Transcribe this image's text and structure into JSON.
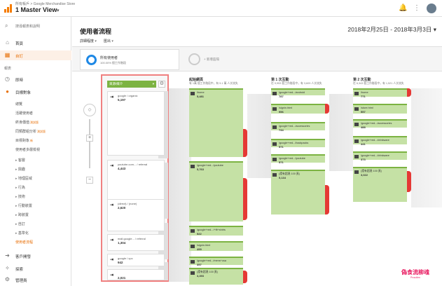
{
  "topbar": {
    "breadcrumb": "所有帳戶 > Google Merchandise Store",
    "view_name": "1 Master View",
    "icons": [
      "bell-icon",
      "more-icon",
      "account-avatar"
    ]
  },
  "sidebar": {
    "search_placeholder": "搜尋報表和說明",
    "top_items": [
      {
        "label": "首頁",
        "icon": "home-icon"
      },
      {
        "label": "自訂",
        "icon": "dashboard-icon"
      }
    ],
    "section_label": "報表",
    "items": [
      {
        "label": "即時",
        "icon": "clock-icon"
      },
      {
        "label": "目標對象",
        "icon": "person-icon"
      }
    ],
    "audience_subitems": [
      {
        "label": "總覽"
      },
      {
        "label": "活躍使用者"
      },
      {
        "label": "終身價值",
        "badge": "測試版"
      },
      {
        "label": "同類群組分析",
        "badge": "測試版"
      },
      {
        "label": "目標對象",
        "badge": "新"
      },
      {
        "label": "使用者多層檢視"
      },
      {
        "label": "客層",
        "arrow": true
      },
      {
        "label": "興趣",
        "arrow": true
      },
      {
        "label": "地理區域",
        "arrow": true
      },
      {
        "label": "行為",
        "arrow": true
      },
      {
        "label": "技術",
        "arrow": true
      },
      {
        "label": "行動裝置",
        "arrow": true
      },
      {
        "label": "跨裝置",
        "arrow": true
      },
      {
        "label": "自訂",
        "arrow": true
      },
      {
        "label": "基準化",
        "arrow": true
      },
      {
        "label": "使用者流程",
        "selected": true
      }
    ],
    "bottom_items": [
      {
        "label": "客戶開發",
        "icon": "acquisition-icon"
      },
      {
        "label": "探索",
        "icon": "discover-icon"
      },
      {
        "label": "管理員",
        "icon": "gear-icon"
      }
    ]
  },
  "main": {
    "title": "使用者流程",
    "date_range": "2018年2月25日 - 2018年3月3日",
    "toolbar": [
      "詳細程度",
      "匯出"
    ],
    "segment": {
      "name": "所有使用者",
      "percent": "100.00% 個工作階段"
    },
    "add_segment": "+ 新增區隔",
    "source_select": "來源/媒介",
    "sources": [
      {
        "name": "google / organic",
        "count": "5,197"
      },
      {
        "name": "youtube.com... / referral",
        "count": "4,443"
      },
      {
        "name": "(direct) / (none)",
        "count": "2,620"
      },
      {
        "name": "mall.google... / referral",
        "count": "1,304"
      },
      {
        "name": "google / cpc",
        "count": "942"
      },
      {
        "name": "",
        "count": "2,021"
      }
    ],
    "columns": [
      {
        "title": "起始網頁",
        "subtitle": "有 1萬 個工作階段中，有 5.1 萬 人次流失",
        "nodes": [
          {
            "name": "/home",
            "count": "5,481"
          },
          {
            "name": "/google+red.../youtube",
            "count": "5,763"
          },
          {
            "name": "/google+red.../+fit+shirts",
            "count": "522"
          },
          {
            "name": "/signin.html",
            "count": "499"
          },
          {
            "name": "/google+red.../mens+usa",
            "count": "357"
          },
          {
            "name": "(還有超過 100 頁)",
            "count": "3,393"
          }
        ]
      },
      {
        "title": "第 1 次互動",
        "subtitle": "在 9,953 個工作階段中，有 3,609 人次流失",
        "nodes": [
          {
            "name": "/google+red.../android",
            "count": "787"
          },
          {
            "name": "/signin.html",
            "count": "956"
          },
          {
            "name": "/google+red.../accessories",
            "count": "734"
          },
          {
            "name": "/google+red.../backpacks",
            "count": "571"
          },
          {
            "name": "/google+red.../youtube",
            "count": "571"
          },
          {
            "name": "(還有超過 100 頁)",
            "count": "5,134"
          }
        ]
      },
      {
        "title": "第 2 次互動",
        "subtitle": "在 6,343 個工作階段中，有 1,521 人次流失",
        "nodes": [
          {
            "name": "/home",
            "count": "771"
          },
          {
            "name": "/store.html",
            "count": "557"
          },
          {
            "name": "/google+red.../accessories",
            "count": "488"
          },
          {
            "name": "/google+red.../drinkware",
            "count": "441"
          },
          {
            "name": "/google+red.../drinkware",
            "count": "373"
          },
          {
            "name": "(還有超過 100 頁)",
            "count": "3,022"
          }
        ]
      }
    ]
  },
  "watermark": {
    "text": "偽食流柳魂",
    "sub": "Proudlen"
  },
  "colors": {
    "accent": "#e8710a",
    "node": "#c5e1a5",
    "node_border": "#7cb342",
    "dropoff": "#e53935",
    "highlight": "#f08080"
  }
}
